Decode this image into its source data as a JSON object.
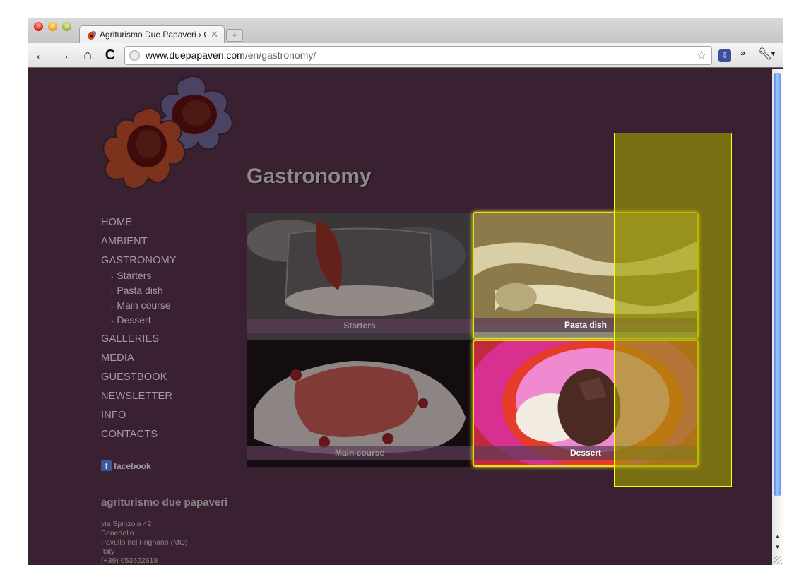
{
  "browser": {
    "tab": {
      "title": "Agriturismo Due Papaveri › G",
      "favicon": "poppy-favicon",
      "close_icon": "close-icon"
    },
    "new_tab_icon": "new-tab-icon",
    "nav": {
      "back_icon": "←",
      "forward_icon": "→",
      "home_icon": "⌂",
      "reload_icon": "C"
    },
    "url": {
      "host": "www.duepapaveri.com",
      "path": "/en/gastronomy/"
    },
    "bookmark_icon": "☆",
    "extension_icon": "extension-icon",
    "overflow_icon": "»",
    "wrench_icon": "wrench-icon"
  },
  "sidebar": {
    "nav": [
      {
        "label": "HOME"
      },
      {
        "label": "AMBIENT"
      },
      {
        "label": "GASTRONOMY"
      }
    ],
    "subnav": [
      {
        "label": "Starters"
      },
      {
        "label": "Pasta dish"
      },
      {
        "label": "Main course"
      },
      {
        "label": "Dessert"
      }
    ],
    "nav2": [
      {
        "label": "GALLERIES"
      },
      {
        "label": "MEDIA"
      },
      {
        "label": "GUESTBOOK"
      },
      {
        "label": "NEWSLETTER"
      },
      {
        "label": "INFO"
      },
      {
        "label": "CONTACTS"
      }
    ],
    "sub_arrow": "›",
    "facebook": {
      "icon": "f",
      "label": "facebook"
    },
    "address": {
      "title": "agriturismo due papaveri",
      "lines": [
        "via Spinzola 42",
        "Benedello",
        "Pavullo nel Frignano (MO)",
        "Italy",
        "(+39) 053622618"
      ]
    }
  },
  "main": {
    "title": "Gastronomy",
    "tiles": [
      {
        "caption": "Starters",
        "highlighted": false
      },
      {
        "caption": "Pasta dish",
        "highlighted": true
      },
      {
        "caption": "Main course",
        "highlighted": false
      },
      {
        "caption": "Dessert",
        "highlighted": true
      }
    ]
  },
  "colors": {
    "page_bg": "#392131",
    "text": "#a49ca2",
    "highlight": "#e8e010",
    "overlay": "#a0a000"
  }
}
